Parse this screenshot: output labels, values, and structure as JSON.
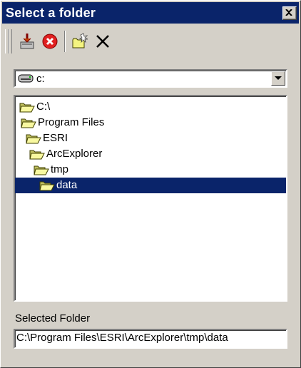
{
  "window": {
    "title": "Select a folder"
  },
  "toolbar": {
    "buttons": [
      {
        "name": "download-folder-icon"
      },
      {
        "name": "stop-icon"
      },
      {
        "name": "new-folder-icon"
      },
      {
        "name": "delete-icon"
      }
    ]
  },
  "drive": {
    "selected": "c:",
    "icon": "drive-icon"
  },
  "tree": {
    "items": [
      {
        "label": "C:\\",
        "depth": 0,
        "selected": false
      },
      {
        "label": "Program Files",
        "depth": 1,
        "selected": false
      },
      {
        "label": "ESRI",
        "depth": 2,
        "selected": false
      },
      {
        "label": "ArcExplorer",
        "depth": 3,
        "selected": false
      },
      {
        "label": "tmp",
        "depth": 4,
        "selected": false
      },
      {
        "label": "data",
        "depth": 5,
        "selected": true
      }
    ]
  },
  "selected_folder": {
    "label": "Selected Folder",
    "path": "C:\\Program Files\\ESRI\\ArcExplorer\\tmp\\data"
  },
  "colors": {
    "titlebar": "#0a246a",
    "selection": "#0a246a",
    "face": "#d4d0c8"
  }
}
